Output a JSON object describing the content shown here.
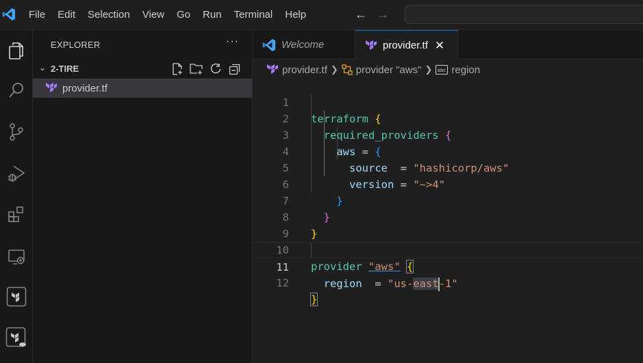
{
  "menu": [
    "File",
    "Edit",
    "Selection",
    "View",
    "Go",
    "Run",
    "Terminal",
    "Help"
  ],
  "sidebar": {
    "title": "EXPLORER",
    "more": "···",
    "folder": "2-TIRE",
    "file": "provider.tf"
  },
  "tabs": {
    "welcome": "Welcome",
    "provider": "provider.tf",
    "close": "✕"
  },
  "breadcrumb": {
    "file": "provider.tf",
    "block": "provider \"aws\"",
    "attr": "region"
  },
  "editor": {
    "active_line": 11,
    "line_numbers": [
      "1",
      "2",
      "3",
      "4",
      "5",
      "6",
      "7",
      "8",
      "9",
      "10",
      "11",
      "12"
    ],
    "code": {
      "l1_kw": "terraform",
      "l2_kw": "required_providers",
      "l3_prop": "aws",
      "l4_prop": "source",
      "l4_eq": "  = ",
      "l4_val": "\"hashicorp/aws\"",
      "l5_prop": "version",
      "l5_eq": " = ",
      "l5_val": "\"~>4\"",
      "l10_kw": "provider",
      "l10_label": "\"aws\"",
      "l11_prop": "region",
      "l11_eq": "  = ",
      "l11_val_a": "\"us-",
      "l11_val_sel": "east",
      "l11_val_b": "-1\""
    }
  },
  "colors": {
    "accent": "#0078d4",
    "terraform_purple": "#7b42bc",
    "keyword": "#4ec9b0",
    "property": "#9cdcfe",
    "string": "#ce9178"
  }
}
